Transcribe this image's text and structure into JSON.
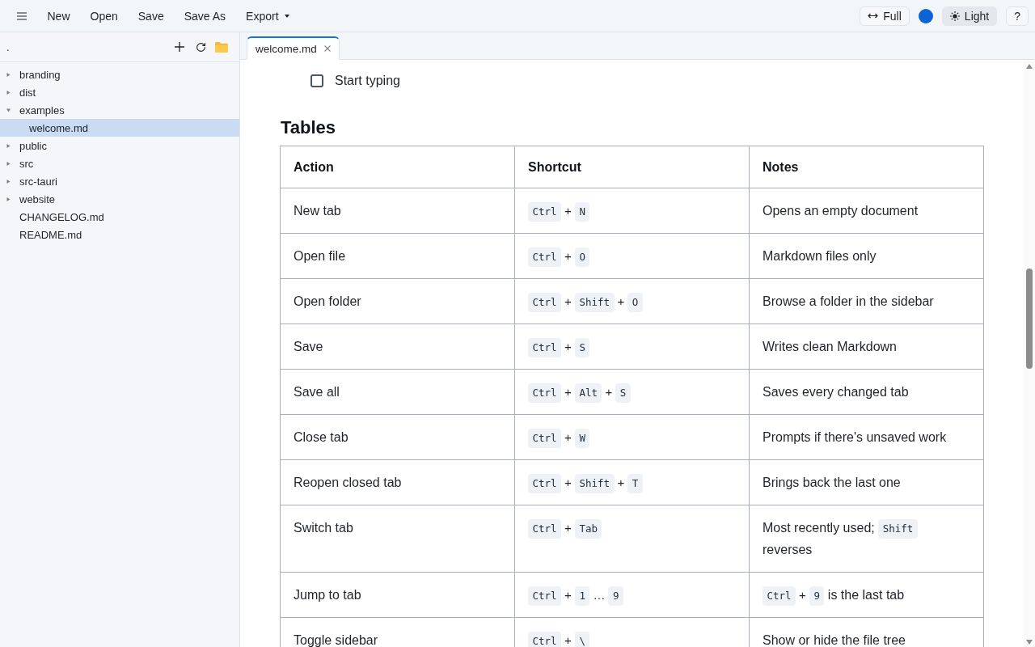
{
  "toolbar": {
    "items": [
      {
        "label": "New",
        "kind": "button"
      },
      {
        "label": "Open",
        "kind": "button"
      },
      {
        "label": "Save",
        "kind": "button"
      },
      {
        "label": "Save As",
        "kind": "button"
      },
      {
        "label": "Export",
        "kind": "dropdown"
      }
    ],
    "width_button": "Full",
    "theme_button": "Light",
    "help_button": "?"
  },
  "sidebar": {
    "path": ".",
    "tree": [
      {
        "name": "branding",
        "kind": "folder",
        "expanded": false,
        "selected": false
      },
      {
        "name": "dist",
        "kind": "folder",
        "expanded": false,
        "selected": false
      },
      {
        "name": "examples",
        "kind": "folder",
        "expanded": true,
        "selected": false,
        "children": [
          {
            "name": "welcome.md",
            "kind": "file",
            "selected": true
          }
        ]
      },
      {
        "name": "public",
        "kind": "folder",
        "expanded": false,
        "selected": false
      },
      {
        "name": "src",
        "kind": "folder",
        "expanded": false,
        "selected": false
      },
      {
        "name": "src-tauri",
        "kind": "folder",
        "expanded": false,
        "selected": false
      },
      {
        "name": "website",
        "kind": "folder",
        "expanded": false,
        "selected": false
      },
      {
        "name": "CHANGELOG.md",
        "kind": "file",
        "selected": false
      },
      {
        "name": "README.md",
        "kind": "file",
        "selected": false
      }
    ]
  },
  "editor": {
    "tabs": [
      {
        "label": "welcome.md",
        "selected": true
      }
    ],
    "document": {
      "task": {
        "text": "Start typing",
        "checked": false
      },
      "heading": "Tables",
      "table": {
        "columns": [
          "Action",
          "Shortcut",
          "Notes"
        ],
        "rows": [
          {
            "action": "New tab",
            "shortcut": [
              {
                "kind": "key",
                "text": "Ctrl"
              },
              {
                "kind": "sep",
                "text": "+"
              },
              {
                "kind": "key",
                "text": "N"
              }
            ],
            "notes": [
              {
                "kind": "text",
                "text": "Opens an empty document"
              }
            ]
          },
          {
            "action": "Open file",
            "shortcut": [
              {
                "kind": "key",
                "text": "Ctrl"
              },
              {
                "kind": "sep",
                "text": "+"
              },
              {
                "kind": "key",
                "text": "O"
              }
            ],
            "notes": [
              {
                "kind": "text",
                "text": "Markdown files only"
              }
            ]
          },
          {
            "action": "Open folder",
            "shortcut": [
              {
                "kind": "key",
                "text": "Ctrl"
              },
              {
                "kind": "sep",
                "text": "+"
              },
              {
                "kind": "key",
                "text": "Shift"
              },
              {
                "kind": "sep",
                "text": "+"
              },
              {
                "kind": "key",
                "text": "O"
              }
            ],
            "notes": [
              {
                "kind": "text",
                "text": "Browse a folder in the sidebar"
              }
            ]
          },
          {
            "action": "Save",
            "shortcut": [
              {
                "kind": "key",
                "text": "Ctrl"
              },
              {
                "kind": "sep",
                "text": "+"
              },
              {
                "kind": "key",
                "text": "S"
              }
            ],
            "notes": [
              {
                "kind": "text",
                "text": "Writes clean Markdown"
              }
            ]
          },
          {
            "action": "Save all",
            "shortcut": [
              {
                "kind": "key",
                "text": "Ctrl"
              },
              {
                "kind": "sep",
                "text": "+"
              },
              {
                "kind": "key",
                "text": "Alt"
              },
              {
                "kind": "sep",
                "text": "+"
              },
              {
                "kind": "key",
                "text": "S"
              }
            ],
            "notes": [
              {
                "kind": "text",
                "text": "Saves every changed tab"
              }
            ]
          },
          {
            "action": "Close tab",
            "shortcut": [
              {
                "kind": "key",
                "text": "Ctrl"
              },
              {
                "kind": "sep",
                "text": "+"
              },
              {
                "kind": "key",
                "text": "W"
              }
            ],
            "notes": [
              {
                "kind": "text",
                "text": "Prompts if there's unsaved work"
              }
            ]
          },
          {
            "action": "Reopen closed tab",
            "shortcut": [
              {
                "kind": "key",
                "text": "Ctrl"
              },
              {
                "kind": "sep",
                "text": "+"
              },
              {
                "kind": "key",
                "text": "Shift"
              },
              {
                "kind": "sep",
                "text": "+"
              },
              {
                "kind": "key",
                "text": "T"
              }
            ],
            "notes": [
              {
                "kind": "text",
                "text": "Brings back the last one"
              }
            ]
          },
          {
            "action": "Switch tab",
            "shortcut": [
              {
                "kind": "key",
                "text": "Ctrl"
              },
              {
                "kind": "sep",
                "text": "+"
              },
              {
                "kind": "key",
                "text": "Tab"
              }
            ],
            "notes": [
              {
                "kind": "text",
                "text": "Most recently used;"
              },
              {
                "kind": "key",
                "text": "Shift"
              },
              {
                "kind": "text",
                "text": "reverses"
              }
            ]
          },
          {
            "action": "Jump to tab",
            "shortcut": [
              {
                "kind": "key",
                "text": "Ctrl"
              },
              {
                "kind": "sep",
                "text": "+"
              },
              {
                "kind": "key",
                "text": "1"
              },
              {
                "kind": "sep",
                "text": "…"
              },
              {
                "kind": "key",
                "text": "9"
              }
            ],
            "notes": [
              {
                "kind": "key",
                "text": "Ctrl"
              },
              {
                "kind": "sep",
                "text": "+"
              },
              {
                "kind": "key",
                "text": "9"
              },
              {
                "kind": "text",
                "text": "is the last tab"
              }
            ]
          },
          {
            "action": "Toggle sidebar",
            "shortcut": [
              {
                "kind": "key",
                "text": "Ctrl"
              },
              {
                "kind": "sep",
                "text": "+"
              },
              {
                "kind": "key",
                "text": "\\"
              }
            ],
            "notes": [
              {
                "kind": "text",
                "text": "Show or hide the file tree"
              }
            ]
          }
        ]
      }
    }
  }
}
